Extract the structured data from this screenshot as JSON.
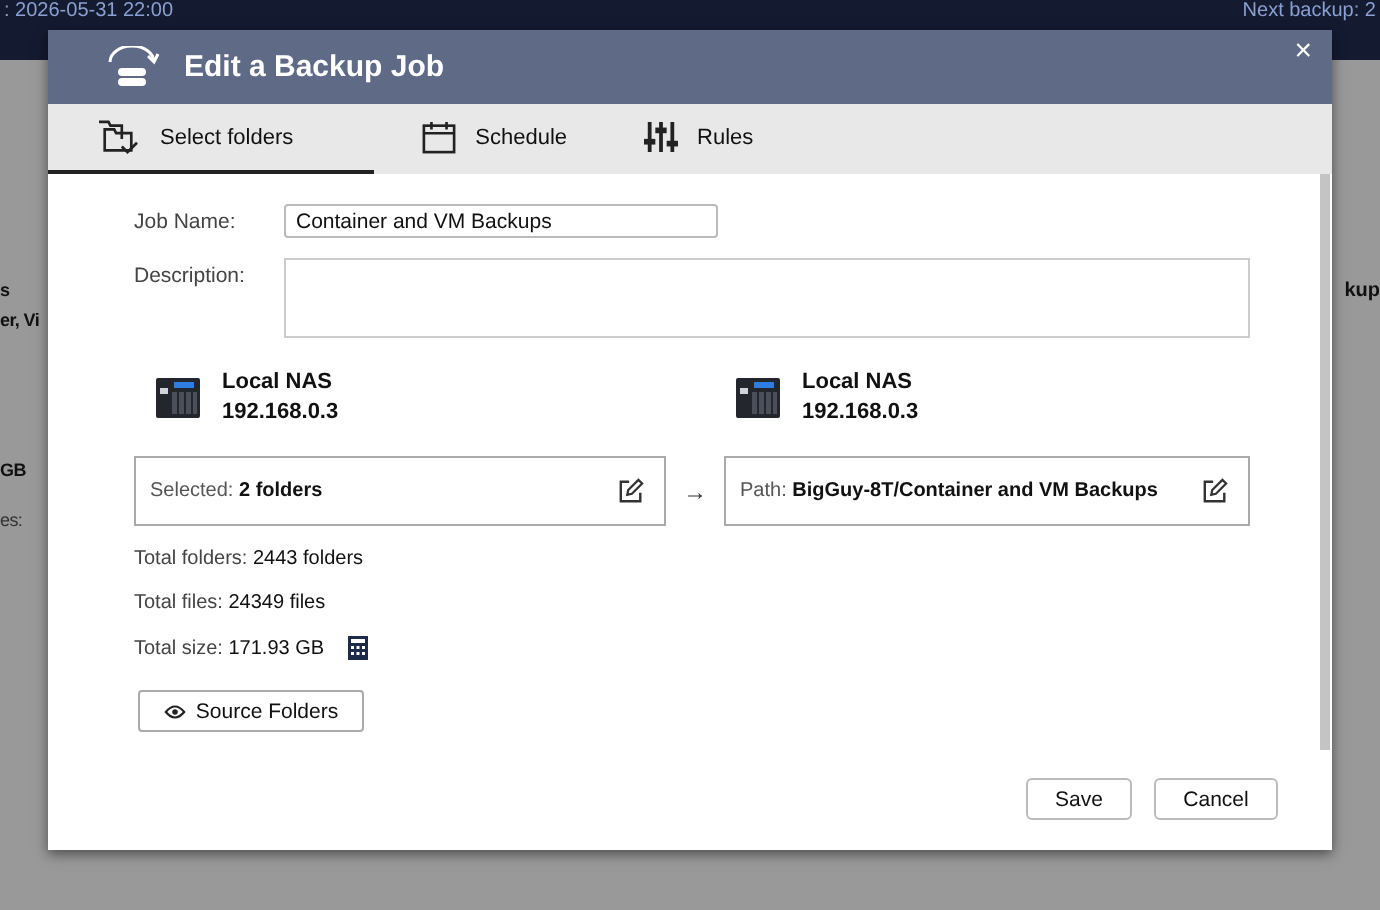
{
  "backdrop": {
    "top_left": ": 2026-05-31 22:00",
    "top_right": "Next backup: 2",
    "left_texts": [
      {
        "text": "s",
        "kind": "bold"
      },
      {
        "text": "er, Vi",
        "kind": "bold"
      },
      {
        "text": "GB",
        "kind": "bold"
      },
      {
        "text": "es:",
        "kind": "plain"
      }
    ],
    "right_texts": [
      {
        "text": "kup",
        "kind": "bold"
      }
    ]
  },
  "dialog": {
    "title": "Edit a Backup Job",
    "close": "×",
    "tabs": [
      {
        "label": "Select folders",
        "selected": true
      },
      {
        "label": "Schedule",
        "selected": false
      },
      {
        "label": "Rules",
        "selected": false
      }
    ],
    "job_name": {
      "label": "Job Name:",
      "value": "Container and VM Backups"
    },
    "description": {
      "label": "Description:"
    },
    "source": {
      "name": "Local NAS",
      "ip": "192.168.0.3",
      "label": "Selected:",
      "value": "2 folders"
    },
    "arrow": "→",
    "destination": {
      "name": "Local NAS",
      "ip": "192.168.0.3",
      "label": "Path:",
      "value": "BigGuy-8T/Container and VM Backups"
    },
    "stats": [
      {
        "label": "Total folders:",
        "value": "2443 folders"
      },
      {
        "label": "Total files:",
        "value": "24349 files"
      },
      {
        "label": "Total size:",
        "value": "171.93 GB",
        "calculator": true
      }
    ],
    "source_folders_button": "Source Folders",
    "buttons": [
      "Save",
      "Cancel"
    ]
  }
}
